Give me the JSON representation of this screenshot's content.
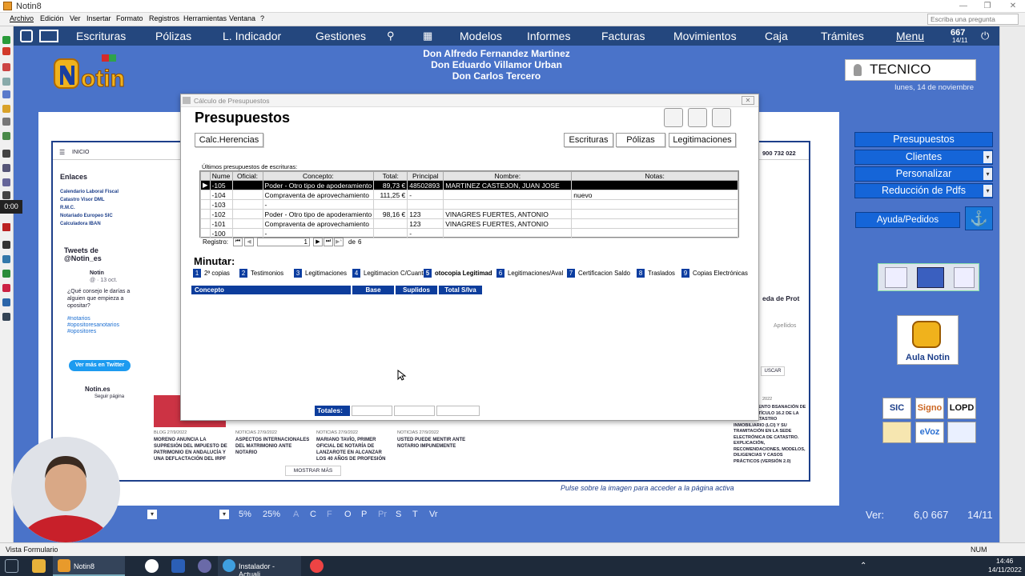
{
  "window": {
    "title": "Notin8"
  },
  "menu": {
    "items": [
      "Archivo",
      "Edición",
      "Ver",
      "Insertar",
      "Formato",
      "Registros",
      "Herramientas",
      "Ventana",
      "?"
    ],
    "ask_placeholder": "Escriba una pregunta"
  },
  "nav": {
    "items": [
      "Escrituras",
      "Pólizas",
      "L. Indicador",
      "Gestiones",
      "Modelos",
      "Informes",
      "Facturas",
      "Movimientos",
      "Caja",
      "Trámites",
      "Menu"
    ],
    "badge_number": "667",
    "badge_date": "14/11"
  },
  "header": {
    "names": [
      "Don Alfredo Fernandez Martinez",
      "Don Eduardo Villamor Urban",
      "Don Carlos Tercero"
    ],
    "logo_text": "Notin",
    "user": "TECNICO",
    "date": "lunes, 14 de noviembre"
  },
  "sidebar": {
    "buttons": [
      "Presupuestos",
      "Clientes",
      "Personalizar",
      "Reducción de Pdfs"
    ],
    "ayuda": "Ayuda/Pedidos",
    "aula": "Aula Notin",
    "brands": [
      "SIC",
      "Signo",
      "LOPD",
      "",
      "eVoz",
      ""
    ]
  },
  "web": {
    "inicio": "INICIO",
    "phone": "900 732 022",
    "enlaces_title": "Enlaces",
    "enlaces": [
      "Calendario Laboral Fiscal",
      "Catastro Visor DML",
      "R.M.C.",
      "Notariado Europeo SIC",
      "Calculadora IBAN"
    ],
    "tweets_title": "Tweets de @Notin_es",
    "tweet_user": "Notin",
    "tweet_meta": "@ · 13 oct.",
    "tweet_text": "¿Qué consejo le darías a alguien que empieza a opositar?",
    "tags": [
      "#notarios",
      "#opositoresanotarios",
      "#opositores"
    ],
    "twitter_btn": "Ver más en Twitter",
    "notin_es": "Notin.es",
    "seguir": "Seguir página",
    "news": [
      {
        "tag": "BLOG 27/9/2022",
        "title": "MORENO ANUNCIA LA SUPRESIÓN DEL IMPUESTO DE PATRIMONIO EN ANDALUCÍA Y UNA DEFLACTACIÓN DEL IRPF"
      },
      {
        "tag": "NOTICIAS 27/9/2022",
        "title": "ASPECTOS INTERNACIONALES DEL MATRIMONIO ANTE NOTARIO"
      },
      {
        "tag": "NOTICIAS 27/9/2022",
        "title": "MARIANO TAVÍO, PRIMER OFICIAL DE NOTARÍA DE LANZAROTE EN ALCANZAR LOS 40 AÑOS DE PROFESIÓN"
      },
      {
        "tag": "NOTICIAS 27/9/2022",
        "title": "USTED PUEDE MENTIR ANTE NOTARIO IMPUNEMENTE"
      }
    ],
    "mostrar": "MOSTRAR MÁS",
    "right_title": "eda de Prot",
    "apellidos": "Apellidos",
    "buscar": "USCAR",
    "right_news": "REQUERIMIENTO BSANACIÓN DE IAS DEL ARTÍCULO 16.2 DE LA LEY DEL CATASTRO INMOBILIARIO (LCI) Y SU TRAMITACIÓN EN LA SEDE ELECTRÓNICA DE CATASTRO. EXPLICACIÓN, RECOMENDACIONES, MODELOS, DILIGENCIAS Y CASOS PRÁCTICOS (VERSIÓN 2.0)",
    "right_date": "2022",
    "pulse": "Pulse sobre la imagen para acceder a la página activa"
  },
  "dialog": {
    "title": "Cálculo de Presupuestos",
    "heading": "Presupuestos",
    "calc_btn": "Calc.Herencias",
    "type_btns": [
      "Escrituras",
      "Pólizas",
      "Legitimaciones"
    ],
    "grid_caption": "Últimos presupuestos de escrituras:",
    "columns": [
      "Nume",
      "Oficial:",
      "Concepto:",
      "Total:",
      "Principal",
      "Nombre:",
      "Notas:"
    ],
    "rows": [
      {
        "num": "-105",
        "oficial": "",
        "concepto": "Poder - Otro tipo de apoderamiento",
        "total": "89,73 €",
        "principal": "48502893",
        "nombre": "MARTINEZ CASTEJON, JUAN JOSE",
        "notas": ""
      },
      {
        "num": "-104",
        "oficial": "",
        "concepto": "Compraventa de aprovechamiento",
        "total": "111,25 €",
        "principal": "-",
        "nombre": "",
        "notas": "nuevo"
      },
      {
        "num": "-103",
        "oficial": "",
        "concepto": "-",
        "total": "",
        "principal": "",
        "nombre": "",
        "notas": ""
      },
      {
        "num": "-102",
        "oficial": "",
        "concepto": "Poder - Otro tipo de apoderamiento",
        "total": "98,16 €",
        "principal": "123",
        "nombre": "VINAGRES FUERTES, ANTONIO",
        "notas": ""
      },
      {
        "num": "-101",
        "oficial": "",
        "concepto": "Compraventa de aprovechamiento",
        "total": "",
        "principal": "123",
        "nombre": "VINAGRES FUERTES, ANTONIO",
        "notas": ""
      },
      {
        "num": "-100",
        "oficial": "",
        "concepto": "-",
        "total": "",
        "principal": "-",
        "nombre": "",
        "notas": ""
      }
    ],
    "registro_label": "Registro:",
    "registro_value": "1",
    "registro_of": "de",
    "registro_total": "6",
    "minutar": "Minutar:",
    "tabs": [
      {
        "n": "1",
        "label": "2ª copias"
      },
      {
        "n": "2",
        "label": "Testimonios"
      },
      {
        "n": "3",
        "label": "Legitimaciones"
      },
      {
        "n": "4",
        "label": "Legitimacion C/Cuanta"
      },
      {
        "n": "5",
        "label": "otocopia Legitimad"
      },
      {
        "n": "6",
        "label": "Legitimaciones/Aval"
      },
      {
        "n": "7",
        "label": "Certificacion Saldo"
      },
      {
        "n": "8",
        "label": "Traslados"
      },
      {
        "n": "9",
        "label": "Copias Electrónicas"
      }
    ],
    "minutar_cols": [
      "Concepto",
      "Base",
      "Suplidos",
      "Total S/Iva"
    ],
    "totales": "Totales:"
  },
  "bottom": {
    "zoom_values": [
      "5%",
      "25%"
    ],
    "letters": [
      "A",
      "C",
      "F",
      "O",
      "P",
      "Pr",
      "S",
      "T",
      "Vr"
    ],
    "ver_label": "Ver:",
    "version": "6,0 667",
    "ver_date": "14/11"
  },
  "status": {
    "text": "Vista Formulario",
    "num": "NUM"
  },
  "taskbar": {
    "items": [
      "Notin8",
      "Instalador - Actuali..."
    ],
    "time": "14:46",
    "date": "14/11/2022"
  },
  "recording": {
    "time": "0:00"
  },
  "colors": {
    "nav": "#24477e",
    "accent": "#1565d8",
    "background": "#4a73c9"
  }
}
